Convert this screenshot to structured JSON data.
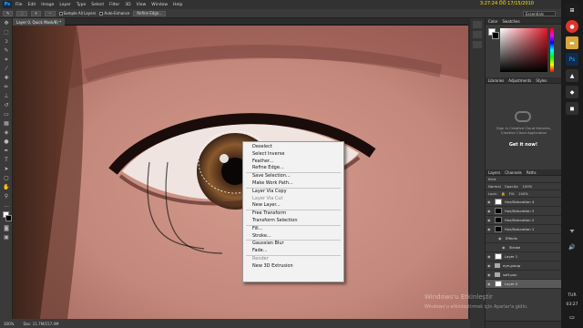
{
  "menubar": {
    "logo": "Ps",
    "items": [
      "File",
      "Edit",
      "Image",
      "Layer",
      "Type",
      "Select",
      "Filter",
      "3D",
      "View",
      "Window",
      "Help"
    ],
    "clock": "3:27:24 ÖÖ 17/15/2010"
  },
  "options": {
    "sample_all_layers": "Sample All Layers",
    "auto_enhance": "Auto-Enhance",
    "refine_edge": "Refine Edge...",
    "workspace": "Essentials"
  },
  "document": {
    "tab_title": "Layer 0, Quick Mask/8) *",
    "zoom": "300%",
    "doc_info": "Doc: 11.7M/157.4M"
  },
  "panels": {
    "color_tabs": [
      "Color",
      "Swatches"
    ],
    "libraries_tabs": [
      "Libraries",
      "Adjustments",
      "Styles"
    ],
    "cc_text": "Sign in Creative Cloud libraries, Creative Cloud Application",
    "cc_link": "Get it now!",
    "layers_tabs": [
      "Layers",
      "Channels",
      "Paths"
    ],
    "kind_label": "Kind",
    "blend_mode": "Normal",
    "opacity_label": "Opacity:",
    "opacity_value": "100%",
    "lock_label": "Lock:",
    "fill_label": "Fill:",
    "fill_value": "100%",
    "layers": [
      {
        "name": "Hue/Saturation 4",
        "thumb": "white"
      },
      {
        "name": "Hue/Saturation 3",
        "thumb": "black"
      },
      {
        "name": "Hue/Saturation 2",
        "thumb": "black"
      },
      {
        "name": "Hue/Saturation 1",
        "thumb": "black"
      },
      {
        "name": "Effects",
        "thumb": "none"
      },
      {
        "name": "Stroke",
        "thumb": "none"
      },
      {
        "name": "Layer 1",
        "thumb": "white"
      },
      {
        "name": "eye-group",
        "thumb": "folder"
      },
      {
        "name": "soft-pov",
        "thumb": "folder"
      },
      {
        "name": "Layer 0",
        "thumb": "white"
      }
    ]
  },
  "context_menu": {
    "groups": [
      [
        "Deselect",
        "Select Inverse",
        "Feather...",
        "Refine Edge..."
      ],
      [
        "Save Selection...",
        "Make Work Path..."
      ],
      [
        "Layer Via Copy",
        "Layer Via Cut",
        "New Layer..."
      ],
      [
        "Free Transform",
        "Transform Selection"
      ],
      [
        "Fill...",
        "Stroke..."
      ],
      [
        "Gaussian Blur",
        "Fade..."
      ],
      [
        "Render",
        "New 3D Extrusion"
      ]
    ],
    "disabled": [
      "Layer Via Cut",
      "Render"
    ]
  },
  "watermark": {
    "title": "Windows'u Etkinleştir",
    "sub": "Windows'u etkinleştirmek için Ayarlar'a gidin."
  },
  "taskbar": {
    "lang": "TUR",
    "time": "03:27"
  }
}
